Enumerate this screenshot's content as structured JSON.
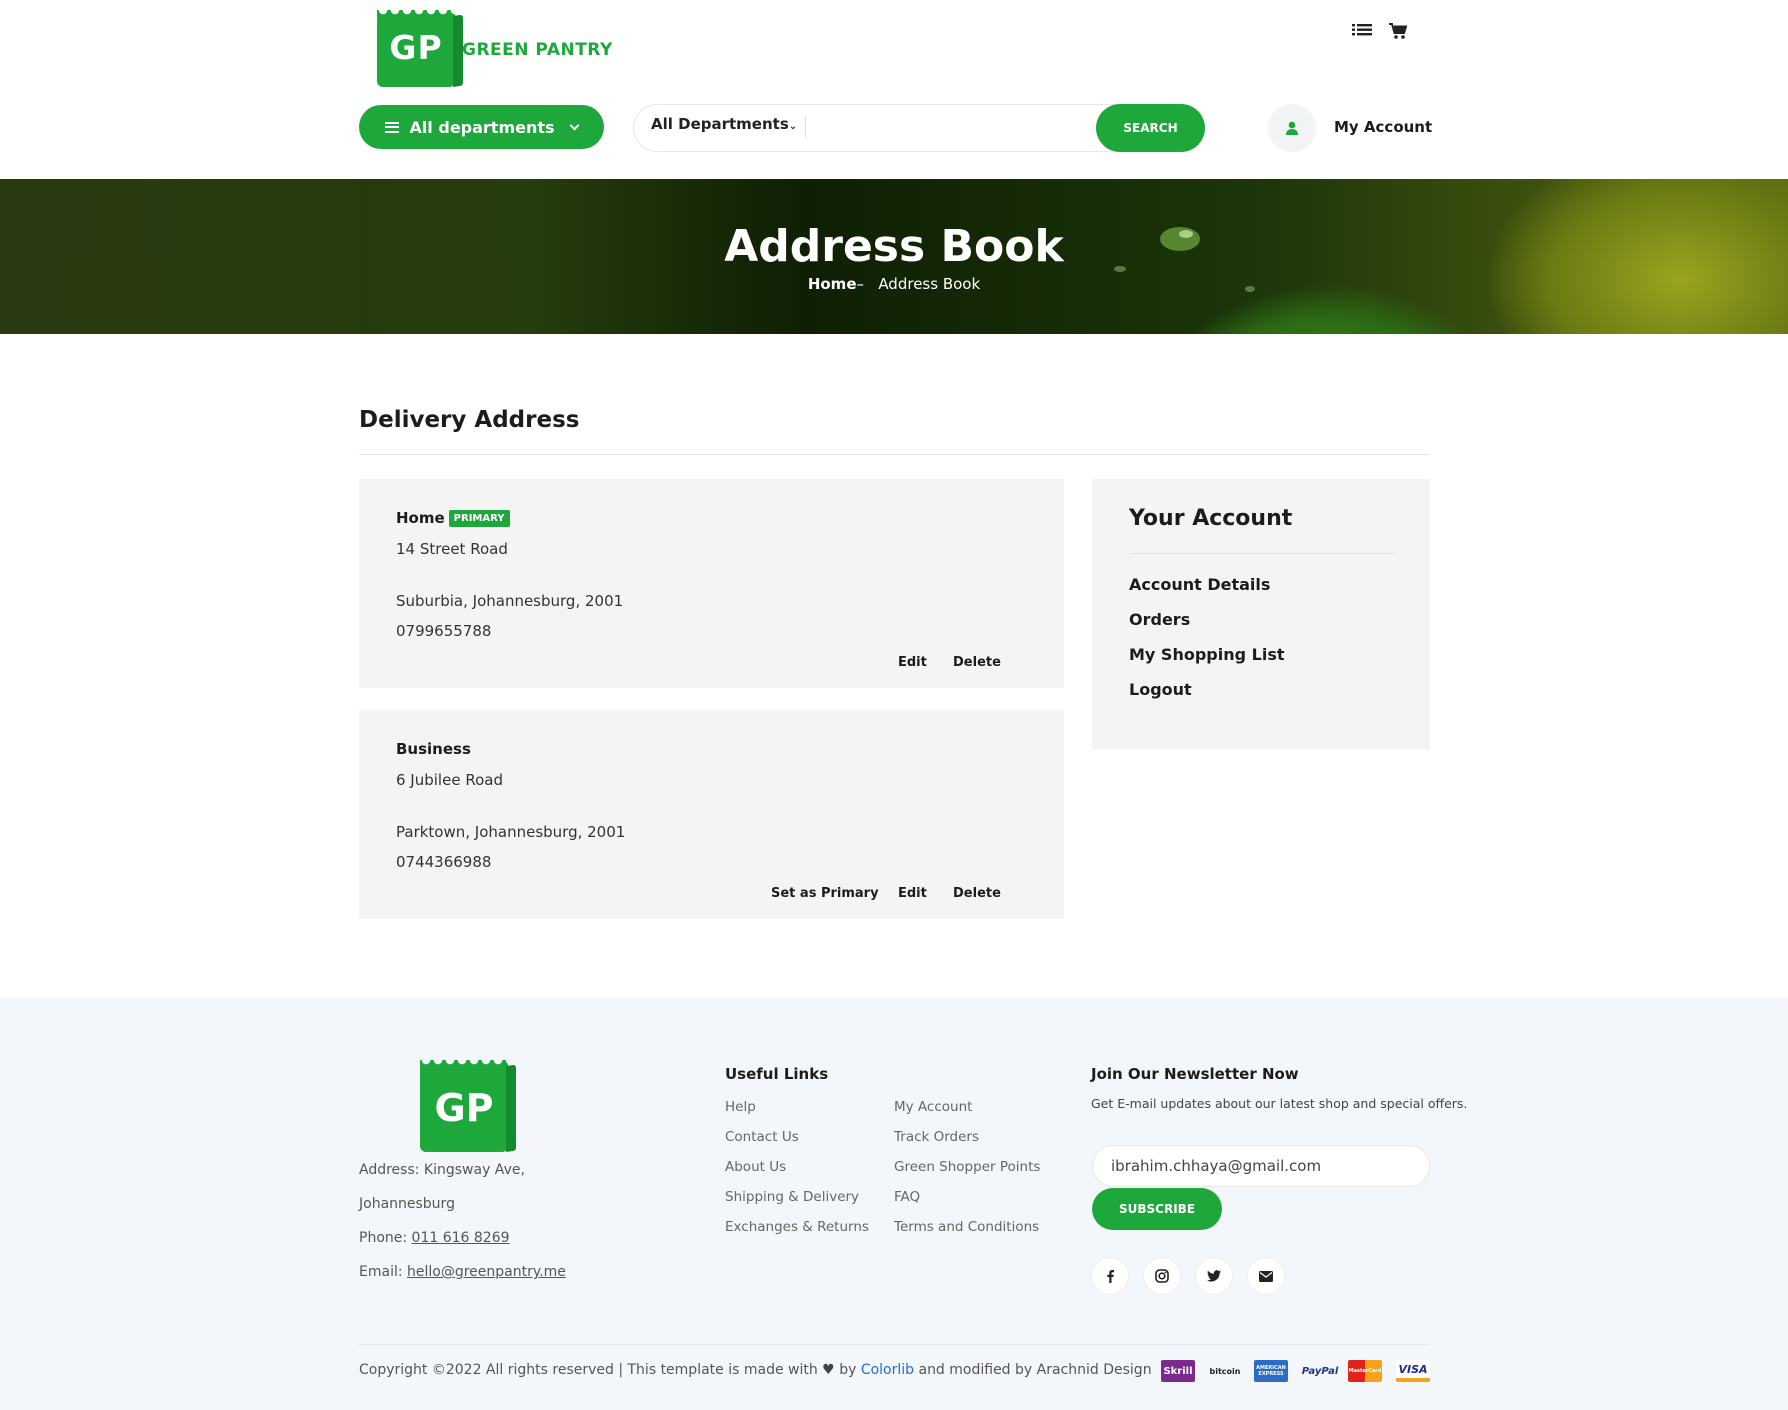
{
  "brand": {
    "logo_letters": "GP",
    "name": "GREEN PANTRY"
  },
  "header": {
    "icons": [
      "list-icon",
      "cart-icon",
      "user-icon"
    ],
    "all_departments_label": "All departments",
    "search_department": "All Departments",
    "search_placeholder": "",
    "search_button": "SEARCH",
    "account_label": "My Account"
  },
  "hero": {
    "title": "Address Book",
    "breadcrumb_home": "Home",
    "breadcrumb_sep": "–",
    "breadcrumb_current": "Address Book"
  },
  "main": {
    "section_title": "Delivery Address",
    "addresses": [
      {
        "name": "Home",
        "badge": "PRIMARY",
        "line1": "14 Street Road",
        "line2": "Suburbia, Johannesburg, 2001",
        "phone": "0799655788",
        "actions": [
          "Edit",
          "Delete"
        ]
      },
      {
        "name": "Business",
        "line1": "6 Jubilee Road",
        "line2": "Parktown, Johannesburg, 2001",
        "phone": "0744366988",
        "actions": [
          "Set as Primary",
          "Edit",
          "Delete"
        ]
      }
    ]
  },
  "account_panel": {
    "title": "Your Account",
    "links": [
      "Account Details",
      "Orders",
      "My Shopping List",
      "Logout"
    ]
  },
  "footer": {
    "address_line1": "Address: Kingsway Ave,",
    "address_line2": "Johannesburg",
    "phone_label": "Phone: ",
    "phone": "011 616 8269",
    "email_label": "Email: ",
    "email": "hello@greenpantry.me",
    "useful_links_title": "Useful Links",
    "links_col1": [
      "Help",
      "Contact Us",
      "About Us",
      "Shipping & Delivery",
      "Exchanges & Returns"
    ],
    "links_col2": [
      "My Account",
      "Track Orders",
      "Green Shopper Points",
      "FAQ",
      "Terms and Conditions"
    ],
    "newsletter_title": "Join Our Newsletter Now",
    "newsletter_desc": "Get E-mail updates about our latest shop and special offers.",
    "newsletter_value": "ibrahim.chhaya@gmail.com",
    "subscribe_label": "SUBSCRIBE",
    "social_icons": [
      "facebook-icon",
      "instagram-icon",
      "twitter-icon",
      "envelope-icon"
    ],
    "copyright_prefix": "Copyright ©2022 All rights reserved | This template is made with",
    "copyright_by": "by",
    "copyright_link": "Colorlib",
    "copyright_suffix": "and modified by Arachnid Design",
    "payments": [
      "Skrill",
      "bitcoin",
      "AMERICAN EXPRESS",
      "PayPal",
      "MasterCard",
      "VISA"
    ]
  },
  "colors": {
    "accent": "#1ea83c",
    "panel": "#f4f4f4",
    "footer_bg": "#f3f6fa"
  }
}
